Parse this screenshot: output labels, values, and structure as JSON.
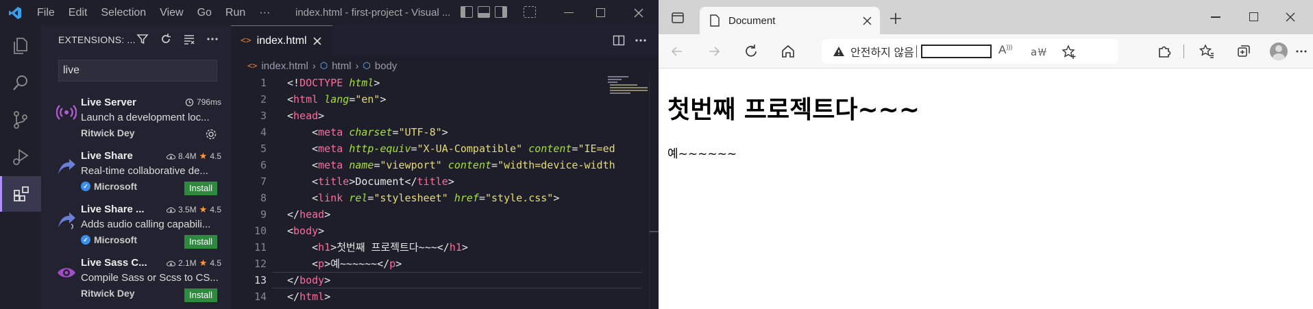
{
  "vscode": {
    "menu": [
      "File",
      "Edit",
      "Selection",
      "View",
      "Go",
      "Run"
    ],
    "more_menu": "···",
    "window_title": "index.html - first-project - Visual ...",
    "sidebar": {
      "header": "EXTENSIONS: ...",
      "search_value": "live",
      "extensions": [
        {
          "name": "Live Server",
          "time": "796ms",
          "description": "Launch a development loc...",
          "publisher": "Ritwick Dey",
          "verified": false,
          "action": "gear"
        },
        {
          "name": "Live Share",
          "downloads": "8.4M",
          "rating": "4.5",
          "description": "Real-time collaborative de...",
          "publisher": "Microsoft",
          "verified": true,
          "action": "Install"
        },
        {
          "name": "Live Share ...",
          "downloads": "3.5M",
          "rating": "4.5",
          "description": "Adds audio calling capabili...",
          "publisher": "Microsoft",
          "verified": true,
          "action": "Install"
        },
        {
          "name": "Live Sass C...",
          "downloads": "2.1M",
          "rating": "4.5",
          "description": "Compile Sass or Scss to CS...",
          "publisher": "Ritwick Dey",
          "verified": false,
          "action": "Install"
        }
      ]
    },
    "editor": {
      "tab_label": "index.html",
      "breadcrumb": [
        "index.html",
        "html",
        "body"
      ],
      "current_line": 13,
      "lines": [
        {
          "n": "1",
          "tokens": [
            [
              "punc",
              "<!"
            ],
            [
              "tag",
              "DOCTYPE"
            ],
            [
              "punc",
              " "
            ],
            [
              "attr",
              "html"
            ],
            [
              "punc",
              ">"
            ]
          ]
        },
        {
          "n": "2",
          "tokens": [
            [
              "punc",
              "<"
            ],
            [
              "tag",
              "html"
            ],
            [
              "punc",
              " "
            ],
            [
              "attr",
              "lang"
            ],
            [
              "punc",
              "="
            ],
            [
              "str",
              "\"en\""
            ],
            [
              "punc",
              ">"
            ]
          ]
        },
        {
          "n": "3",
          "tokens": [
            [
              "punc",
              "<"
            ],
            [
              "tag",
              "head"
            ],
            [
              "punc",
              ">"
            ]
          ]
        },
        {
          "n": "4",
          "tokens": [
            [
              "punc",
              "    <"
            ],
            [
              "tag",
              "meta"
            ],
            [
              "punc",
              " "
            ],
            [
              "attr",
              "charset"
            ],
            [
              "punc",
              "="
            ],
            [
              "str",
              "\"UTF-8\""
            ],
            [
              "punc",
              ">"
            ]
          ]
        },
        {
          "n": "5",
          "tokens": [
            [
              "punc",
              "    <"
            ],
            [
              "tag",
              "meta"
            ],
            [
              "punc",
              " "
            ],
            [
              "attr",
              "http-equiv"
            ],
            [
              "punc",
              "="
            ],
            [
              "str",
              "\"X-UA-Compatible\""
            ],
            [
              "punc",
              " "
            ],
            [
              "attr",
              "content"
            ],
            [
              "punc",
              "="
            ],
            [
              "str",
              "\"IE=ed"
            ]
          ]
        },
        {
          "n": "6",
          "tokens": [
            [
              "punc",
              "    <"
            ],
            [
              "tag",
              "meta"
            ],
            [
              "punc",
              " "
            ],
            [
              "attr",
              "name"
            ],
            [
              "punc",
              "="
            ],
            [
              "str",
              "\"viewport\""
            ],
            [
              "punc",
              " "
            ],
            [
              "attr",
              "content"
            ],
            [
              "punc",
              "="
            ],
            [
              "str",
              "\"width=device-width"
            ]
          ]
        },
        {
          "n": "7",
          "tokens": [
            [
              "punc",
              "    <"
            ],
            [
              "tag",
              "title"
            ],
            [
              "punc",
              ">Document</"
            ],
            [
              "tag",
              "title"
            ],
            [
              "punc",
              ">"
            ]
          ]
        },
        {
          "n": "8",
          "tokens": [
            [
              "punc",
              "    <"
            ],
            [
              "tag",
              "link"
            ],
            [
              "punc",
              " "
            ],
            [
              "attr",
              "rel"
            ],
            [
              "punc",
              "="
            ],
            [
              "str",
              "\"stylesheet\""
            ],
            [
              "punc",
              " "
            ],
            [
              "attr",
              "href"
            ],
            [
              "punc",
              "="
            ],
            [
              "str",
              "\"style.css\""
            ],
            [
              "punc",
              ">"
            ]
          ]
        },
        {
          "n": "9",
          "tokens": [
            [
              "punc",
              "</"
            ],
            [
              "tag",
              "head"
            ],
            [
              "punc",
              ">"
            ]
          ]
        },
        {
          "n": "10",
          "tokens": [
            [
              "punc",
              "<"
            ],
            [
              "tag",
              "body"
            ],
            [
              "punc",
              ">"
            ]
          ]
        },
        {
          "n": "11",
          "tokens": [
            [
              "punc",
              "    <"
            ],
            [
              "tag",
              "h1"
            ],
            [
              "punc",
              ">첫번째 프로젝트다~~~</"
            ],
            [
              "tag",
              "h1"
            ],
            [
              "punc",
              ">"
            ]
          ]
        },
        {
          "n": "12",
          "tokens": [
            [
              "punc",
              "    <"
            ],
            [
              "tag",
              "p"
            ],
            [
              "punc",
              ">예~~~~~~</"
            ],
            [
              "tag",
              "p"
            ],
            [
              "punc",
              ">"
            ]
          ]
        },
        {
          "n": "13",
          "tokens": [
            [
              "punc",
              "</"
            ],
            [
              "tag",
              "body"
            ],
            [
              "punc",
              ">"
            ]
          ]
        },
        {
          "n": "14",
          "tokens": [
            [
              "punc",
              "</"
            ],
            [
              "tag",
              "html"
            ],
            [
              "punc",
              ">"
            ]
          ]
        }
      ]
    }
  },
  "edge": {
    "tab_title": "Document",
    "address_label": "안전하지 않음",
    "page": {
      "h1": "첫번째 프로젝트다~~~",
      "p": "예~~~~~~"
    }
  },
  "colors": {
    "accent": "#7a5af8",
    "install": "#2e8b3e",
    "tag": "#ff6b9a",
    "attr": "#a6e22e",
    "str": "#e6db74"
  }
}
